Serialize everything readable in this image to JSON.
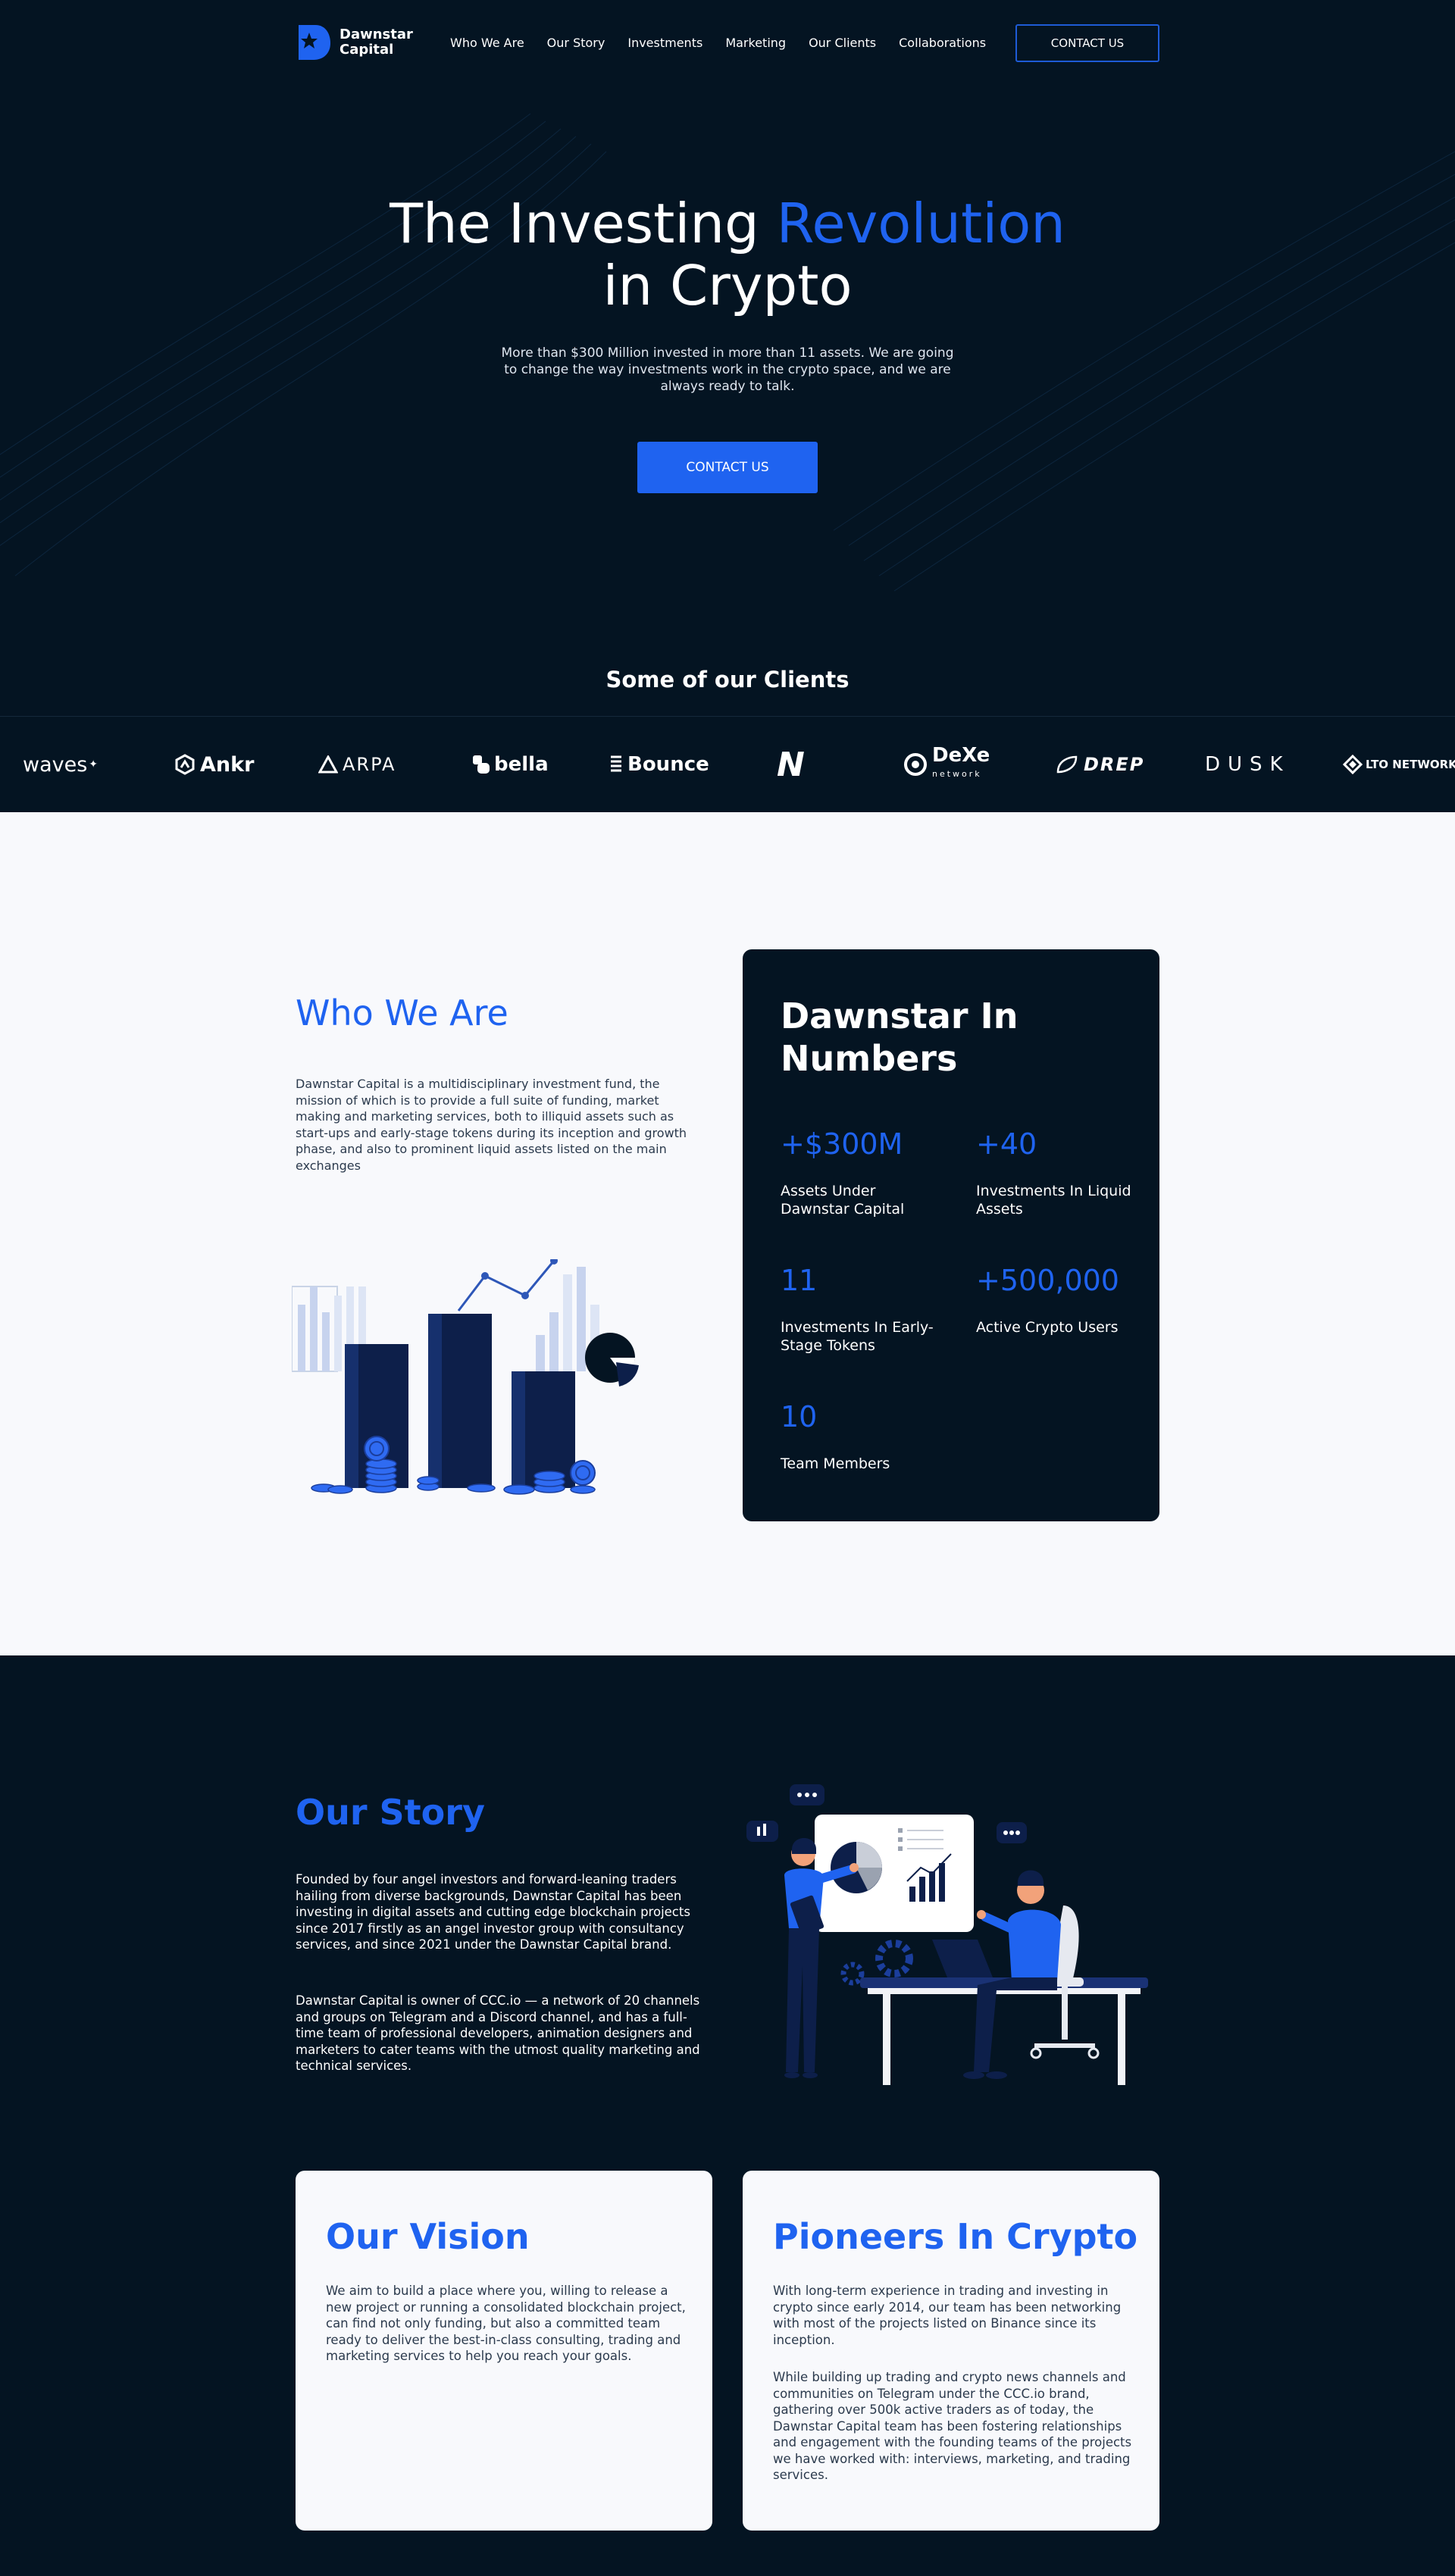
{
  "nav": {
    "logo_text": "Dawnstar Capital",
    "links": [
      "Who We Are",
      "Our Story",
      "Investments",
      "Marketing",
      "Our Clients",
      "Collaborations"
    ],
    "cta": "CONTACT US"
  },
  "hero": {
    "title_part1": "The Investing ",
    "title_accent": "Revolution",
    "title_line2": "in Crypto",
    "subtitle": "More than $300 Million invested in more than 11 assets. We are going to change the way investments work in the crypto space, and we are always ready to talk.",
    "cta": "CONTACT US"
  },
  "clients": {
    "title": "Some of our Clients",
    "logos": [
      "waves",
      "Ankr",
      "ARPA",
      "bella",
      "Bounce",
      "N",
      "DeXe",
      "network",
      "DREP",
      "DUSK",
      "LTO NETWORK"
    ]
  },
  "who": {
    "title": "Who We Are",
    "text": "Dawnstar Capital is a multidisciplinary investment fund, the mission of which is to provide a full suite of funding, market making and marketing services, both to illiquid assets such as start-ups and early-stage tokens during its inception and growth phase, and also to prominent liquid assets listed on the main exchanges"
  },
  "numbers": {
    "title": "Dawnstar In Numbers",
    "stats": [
      {
        "value": "+$300M",
        "label": "Assets Under Dawnstar Capital"
      },
      {
        "value": "+40",
        "label": "Investments In Liquid Assets"
      },
      {
        "value": "11",
        "label": "Investments In Early-Stage Tokens"
      },
      {
        "value": "+500,000",
        "label": "Active Crypto Users"
      },
      {
        "value": "10",
        "label": "Team Members"
      }
    ]
  },
  "story": {
    "title": "Our Story",
    "p1": "Founded by four angel investors and forward-leaning traders hailing from diverse backgrounds, Dawnstar Capital has been investing in digital assets and cutting edge blockchain projects since 2017 firstly as an angel investor group with consultancy services, and since 2021 under the Dawnstar Capital brand.",
    "p2": "Dawnstar Capital is owner of CCC.io — a network of 20 channels and groups on Telegram and a Discord channel, and has a full-time team of professional developers, animation designers and marketers to cater teams with the utmost quality marketing and technical services."
  },
  "vision": {
    "title": "Our Vision",
    "text": "We aim to build a place where you, willing to release a new project or running a consolidated blockchain project, can find not only funding, but also a committed team ready to deliver the best-in-class consulting, trading and marketing services to help you reach your goals."
  },
  "pioneers": {
    "title": "Pioneers In Crypto",
    "p1": "With long-term experience in trading and investing in crypto since early 2014, our team has been networking with most of the projects listed on Binance since its inception.",
    "p2": "While building up trading and crypto news channels and communities on Telegram under the CCC.io brand, gathering over 500k active traders as of today, the Dawnstar Capital team has been fostering relationships and engagement with the founding teams of the projects we have worked with: interviews, marketing, and trading services."
  },
  "colors": {
    "accent": "#1f63f0",
    "dark_bg": "#041422",
    "light_bg": "#f8f9fc",
    "navy": "#0d1f4a"
  },
  "icons": [
    "logo-mark-icon",
    "bar-chart-illustration",
    "office-team-illustration"
  ]
}
